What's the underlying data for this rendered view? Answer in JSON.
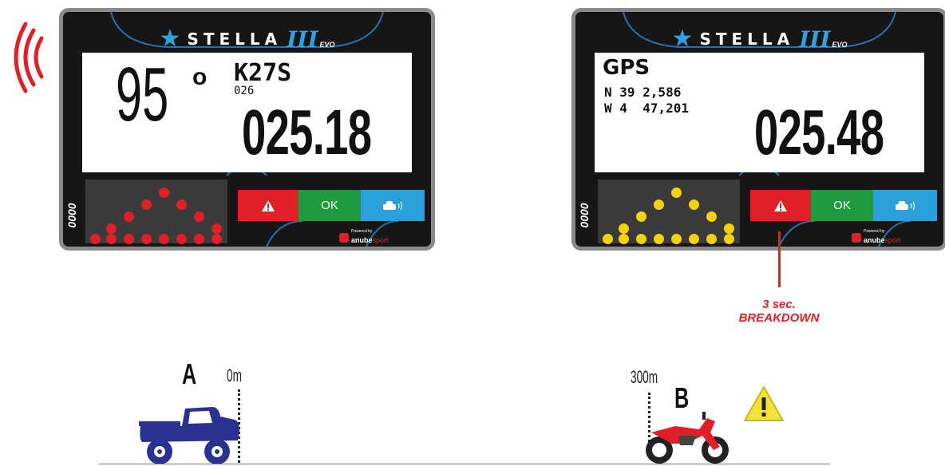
{
  "brand": {
    "name": "STELLA",
    "version": "III",
    "suffix": "EVO"
  },
  "powered_by": {
    "small": "Powered by",
    "name_part1": "anube",
    "name_part2": "sport"
  },
  "buttons": {
    "ok": "OK"
  },
  "device_left": {
    "counter": "0000",
    "heading": "95",
    "degree": "o",
    "code": "K27S",
    "subcode": "026",
    "distance": "025.18",
    "led_color": "#e01f26"
  },
  "device_right": {
    "counter": "0000",
    "mode": "GPS",
    "lat": "N 39 2,586",
    "lon": "W 4  47,201",
    "distance": "025.48",
    "led_color": "#f3d10b"
  },
  "callout": {
    "line1": "3 sec.",
    "line2": "BREAKDOWN"
  },
  "scene": {
    "point_a": {
      "label": "A",
      "distance": "0m"
    },
    "point_b": {
      "label": "B",
      "distance": "300m"
    }
  },
  "colors": {
    "alert": "#e01f26",
    "ok": "#1e9b3e",
    "car": "#2b9fd8",
    "truck": "#2a3290",
    "warning": "#f1e33a"
  },
  "icons": [
    "star-logo-icon",
    "warning-triangle-icon",
    "car-signal-icon",
    "signal-waves-icon",
    "truck-icon",
    "motorbike-icon"
  ]
}
